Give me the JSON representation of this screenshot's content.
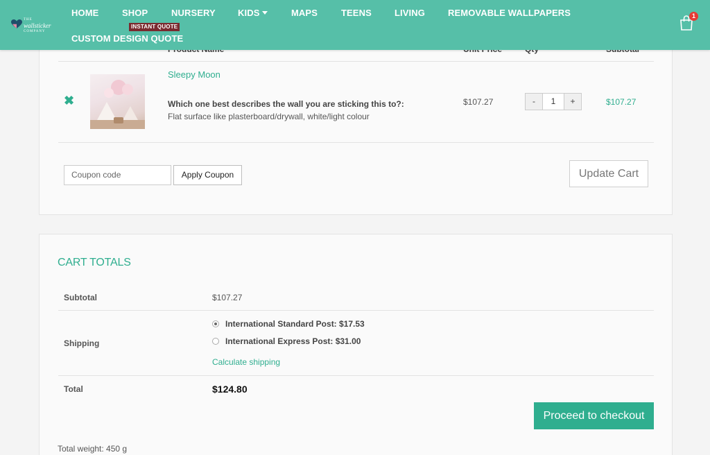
{
  "header": {
    "logo": {
      "line1": "THE",
      "line2": "wallsticker",
      "line3": "COMPANY"
    },
    "nav": [
      {
        "label": "HOME"
      },
      {
        "label": "SHOP"
      },
      {
        "label": "NURSERY"
      },
      {
        "label": "KIDS"
      },
      {
        "label": "MAPS"
      },
      {
        "label": "TEENS"
      },
      {
        "label": "LIVING"
      },
      {
        "label": "REMOVABLE WALLPAPERS"
      },
      {
        "label": "CUSTOM DESIGN QUOTE"
      }
    ],
    "quote_badge": "INSTANT QUOTE",
    "cart_count": "1",
    "brand_color": "#56bfa8",
    "accent_color": "#2fae8f"
  },
  "cart": {
    "columns": [
      "Product Name",
      "Unit Price",
      "Qty",
      "Subtotal"
    ],
    "item": {
      "name": "Sleepy Moon",
      "question": "Which one best describes the wall you are sticking this to?:",
      "answer": "Flat surface like plasterboard/drywall, white/light colour",
      "unit_price": "$107.27",
      "qty": "1",
      "qty_minus": "-",
      "qty_plus": "+",
      "subtotal": "$107.27"
    },
    "coupon_placeholder": "Coupon code",
    "apply_label": "Apply Coupon",
    "update_label": "Update Cart"
  },
  "totals": {
    "title": "CART TOTALS",
    "subtotal_label": "Subtotal",
    "subtotal_value": "$107.27",
    "shipping_label": "Shipping",
    "shipping_options": [
      {
        "label": "International Standard Post: $17.53",
        "selected": true
      },
      {
        "label": "International Express Post: $31.00",
        "selected": false
      }
    ],
    "calculate_label": "Calculate shipping",
    "total_label": "Total",
    "total_value": "$124.80",
    "checkout_label": "Proceed to checkout",
    "weight": "Total weight: 450 g"
  }
}
